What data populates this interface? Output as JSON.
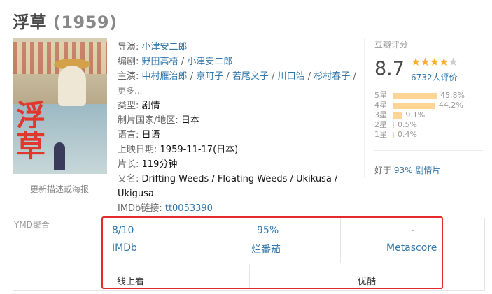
{
  "movie": {
    "title": "浮草",
    "year": "(1959)"
  },
  "poster": {
    "kanji": "浮草",
    "update_link": "更新描述或海报"
  },
  "info": {
    "director_label": "导演:",
    "director": "小津安二郎",
    "writer_label": "编剧:",
    "writers": [
      "野田高梧",
      "小津安二郎"
    ],
    "cast_label": "主演:",
    "cast": [
      "中村雁治郎",
      "京町子",
      "若尾文子",
      "川口浩",
      "杉村春子"
    ],
    "more": "更多...",
    "genre_label": "类型:",
    "genre": "剧情",
    "country_label": "制片国家/地区:",
    "country": "日本",
    "language_label": "语言:",
    "language": "日语",
    "release_label": "上映日期:",
    "release": "1959-11-17(日本)",
    "runtime_label": "片长:",
    "runtime": "119分钟",
    "aka_label": "又名:",
    "aka_line1": "Drifting Weeds / Floating Weeds / Ukikusa /",
    "aka_line2": "Ukigusa",
    "imdb_label": "IMDb链接:",
    "imdb_id": "tt0053390"
  },
  "rating": {
    "title": "豆瓣评分",
    "score": "8.7",
    "stars_value": 4.5,
    "votes": "6732人评价",
    "distribution": [
      {
        "label": "5星",
        "percent": 45.8,
        "text": "45.8%"
      },
      {
        "label": "4星",
        "percent": 44.2,
        "text": "44.2%"
      },
      {
        "label": "3星",
        "percent": 9.1,
        "text": "9.1%"
      },
      {
        "label": "2星",
        "percent": 0.5,
        "text": "0.5%"
      },
      {
        "label": "1星",
        "percent": 0.4,
        "text": "0.4%"
      }
    ],
    "better_than_prefix": "好于",
    "better_than_value": "93%",
    "better_than_genre": "剧情片"
  },
  "aggregate": {
    "label": "YMD聚合",
    "scores": [
      {
        "value": "8/10",
        "name": "IMDb"
      },
      {
        "value": "95%",
        "name": "烂番茄"
      },
      {
        "value": "-",
        "name": "Metascore"
      }
    ],
    "watch": [
      "线上看",
      "优酷"
    ],
    "highlight_color": "#e32b2b"
  }
}
